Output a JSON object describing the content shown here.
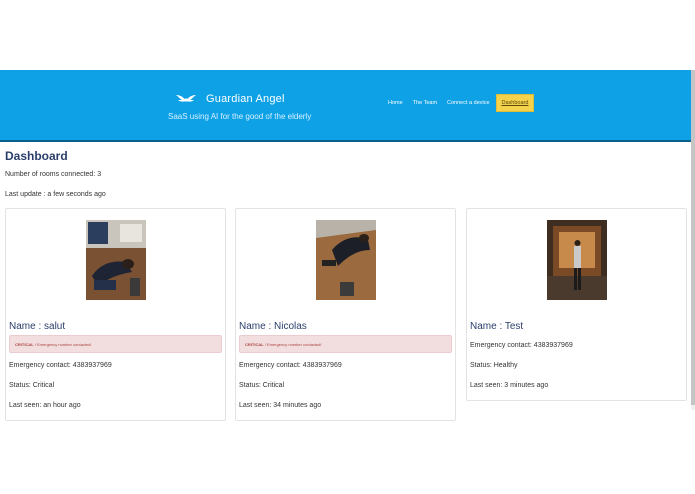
{
  "header": {
    "brand_name": "Guardian Angel",
    "tagline": "SaaS using AI for the good of the elderly",
    "logo_icon": "wings-icon",
    "nav": [
      {
        "label": "Home"
      },
      {
        "label": "The Team"
      },
      {
        "label": "Connect a device"
      },
      {
        "label": "Dashboard"
      }
    ],
    "colors": {
      "header_bg": "#0ea1e6",
      "active_nav": "#f5d24b"
    }
  },
  "dashboard": {
    "title": "Dashboard",
    "rooms_connected": "Number of rooms connected: 3",
    "last_update": "Last update : a few seconds ago"
  },
  "cards": [
    {
      "name": "Name : salut",
      "alert_strong": "CRITICAL",
      "alert_text": " ! Emergency number contacted!",
      "emergency": "Emergency contact: 4383937969",
      "status": "Status: Critical",
      "last_seen": "Last seen: an hour ago"
    },
    {
      "name": "Name : Nicolas",
      "alert_strong": "CRITICAL",
      "alert_text": " ! Emergency number contacted!",
      "emergency": "Emergency contact: 4383937969",
      "status": "Status: Critical",
      "last_seen": "Last seen: 34 minutes ago"
    },
    {
      "name": "Name : Test",
      "emergency": "Emergency contact: 4383937969",
      "status": "Status: Healthy",
      "last_seen": "Last seen: 3 minutes ago"
    }
  ]
}
